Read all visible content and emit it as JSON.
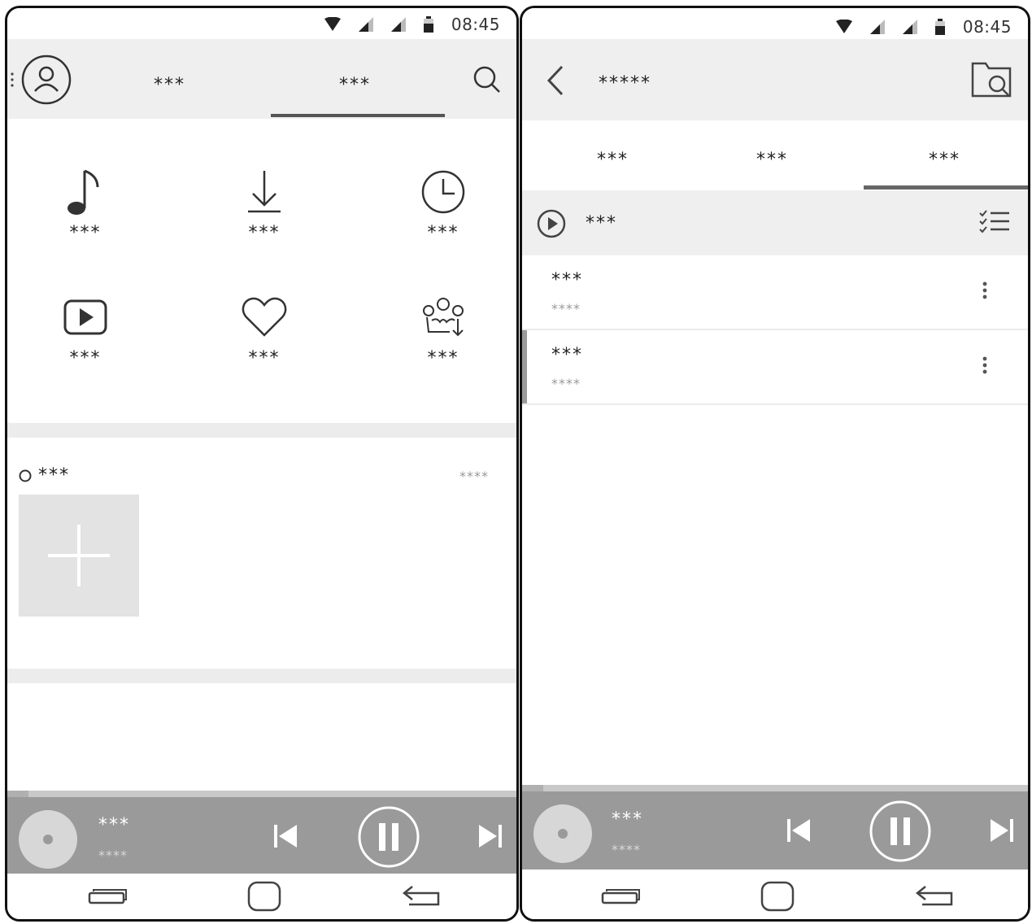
{
  "status_bar": {
    "time": "08:45"
  },
  "left_screen": {
    "header": {
      "tabs": [
        {
          "label": "***"
        },
        {
          "label": "***",
          "selected": true
        }
      ]
    },
    "grid": [
      {
        "icon": "music-note-icon",
        "label": "***"
      },
      {
        "icon": "download-icon",
        "label": "***"
      },
      {
        "icon": "clock-icon",
        "label": "***"
      },
      {
        "icon": "video-play-icon",
        "label": "***"
      },
      {
        "icon": "heart-icon",
        "label": "***"
      },
      {
        "icon": "crown-download-icon",
        "label": "***"
      }
    ],
    "playlist": {
      "title": "***",
      "more": "****"
    }
  },
  "right_screen": {
    "header": {
      "title": "*****"
    },
    "tabs": [
      {
        "label": "***"
      },
      {
        "label": "***"
      },
      {
        "label": "***",
        "selected": true
      }
    ],
    "play_all": {
      "label": "***"
    },
    "songs": [
      {
        "title": "***",
        "subtitle": "****"
      },
      {
        "title": "***",
        "subtitle": "****",
        "active": true
      }
    ]
  },
  "player": {
    "title": "***",
    "subtitle": "****",
    "state": "playing"
  },
  "colors": {
    "player_bg": "#9a9a9a",
    "header_bg": "#efefef",
    "separator": "#ececec"
  }
}
